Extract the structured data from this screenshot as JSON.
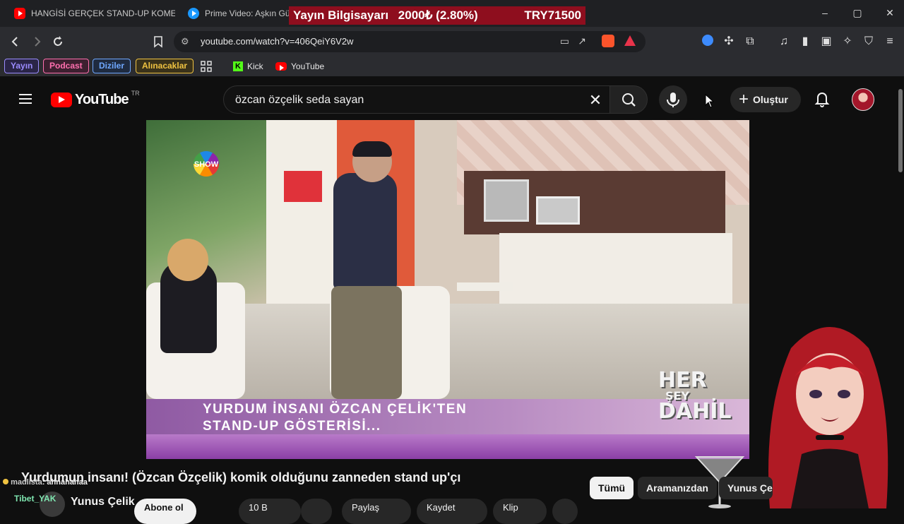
{
  "browser": {
    "tabs": [
      {
        "label": "HANGİSİ GERÇEK STAND-UP KOMEDİ",
        "favicon": "youtube-icon"
      },
      {
        "label": "Prime Video: Aşkın Güc",
        "favicon": "prime-video-icon"
      }
    ],
    "address": "youtube.com/watch?v=406QeiY6V2w",
    "bookmarks": [
      {
        "label": "Yayın",
        "color": "#9b8cff"
      },
      {
        "label": "Podcast",
        "color": "#ff6fae"
      },
      {
        "label": "Diziler",
        "color": "#6fa8ff"
      },
      {
        "label": "Alınacaklar",
        "color": "#f0c341"
      }
    ],
    "bookmark_links": [
      {
        "label": "Kick",
        "icon": "kick-icon"
      },
      {
        "label": "YouTube",
        "icon": "youtube-icon"
      }
    ],
    "window_controls": {
      "minimize": "–",
      "maximize": "▢",
      "close": "✕"
    }
  },
  "stream_overlay": {
    "banner_label": "Yayın Bilgisayarı",
    "banner_rate": "2000₺ (2.80%)",
    "banner_goal": "TRY71500",
    "chat": [
      {
        "user": "madlista",
        "message": ": ahnahahaa"
      },
      {
        "user": "Tibet_YAK",
        "message": ""
      }
    ]
  },
  "youtube": {
    "logo_text": "YouTube",
    "region": "TR",
    "search_query": "özcan özçelik seda sayan",
    "create_label": "Oluştur",
    "video": {
      "caption_line1": "YURDUM İNSANI ÖZCAN ÇELİK'TEN",
      "caption_line2": "STAND-UP GÖSTERİSİ...",
      "channel_logo": "SHOW",
      "program_logo_lines": [
        "HER",
        "ŞEY",
        "DAHİL"
      ]
    },
    "title": "Yurdumun insanı! (Özcan Özçelik) komik olduğunu zanneden stand up'çı",
    "channel": "Yunus Çelik",
    "chips": [
      "Tümü",
      "Aramanızdan",
      "Yunus Çe"
    ],
    "actions": [
      "Abone ol",
      "10 B",
      "Paylaş",
      "Kaydet",
      "Klip"
    ]
  },
  "colors": {
    "banner": "#8e0e1e",
    "yt_red": "#ff0000",
    "bg": "#0f0f0f"
  }
}
